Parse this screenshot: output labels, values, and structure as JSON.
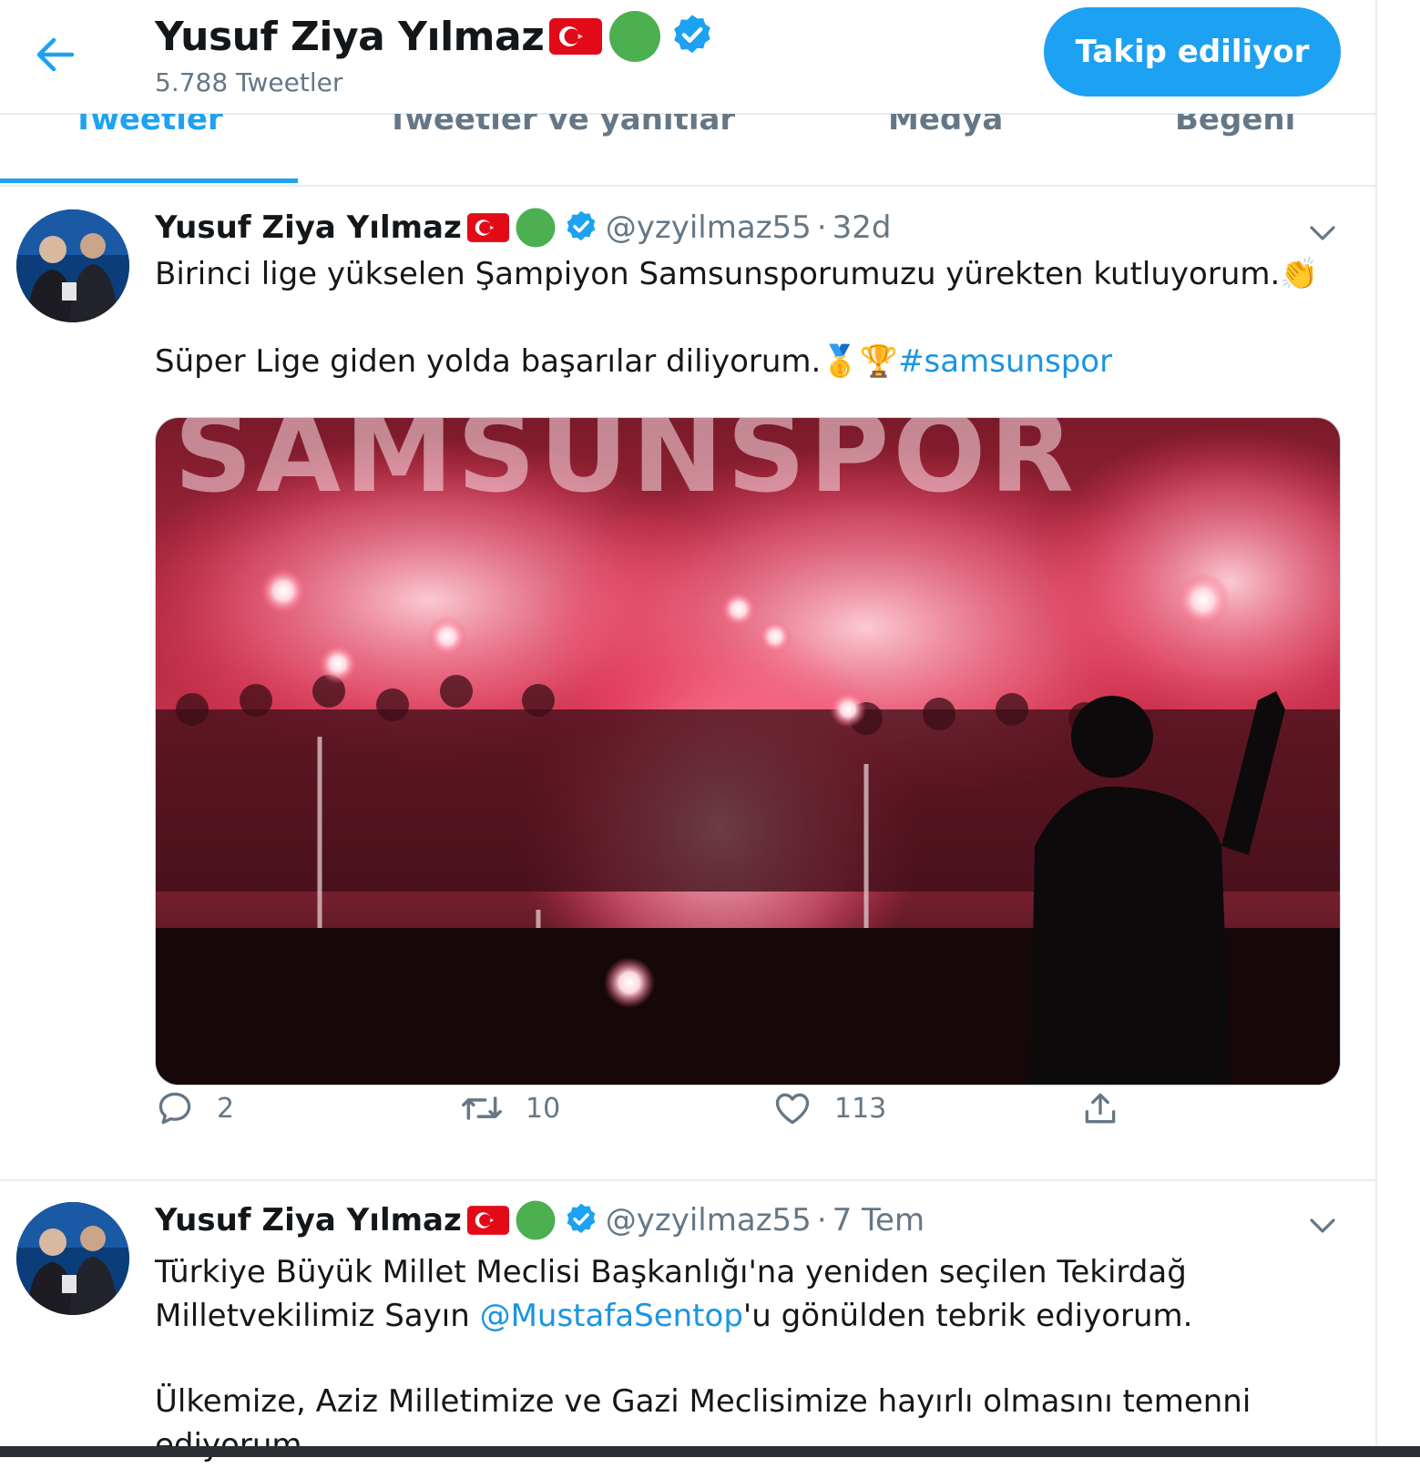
{
  "header": {
    "name": "Yusuf Ziya Yılmaz",
    "tweet_count": "5.788 Tweetler",
    "follow_label": "Takip ediliyor"
  },
  "tabs": [
    {
      "label": "Tweetler",
      "active": true
    },
    {
      "label": "Tweetler ve yanıtlar",
      "active": false
    },
    {
      "label": "Medya",
      "active": false
    },
    {
      "label": "Beğeni",
      "active": false
    }
  ],
  "tweets": [
    {
      "name": "Yusuf Ziya Yılmaz",
      "handle": "@yzyilmaz55",
      "separator": "·",
      "time": "32d",
      "line1": "Birinci lige yükselen Şampiyon  Samsunsporumuzu yürekten kutluyorum.",
      "line1_emoji": "👏",
      "line2": "Süper Lige giden yolda başarılar diliyorum.",
      "line2_emoji": "🥇🏆",
      "hashtag": "#samsunspor",
      "media_watermark": "SAMSUNSPOR",
      "replies": "2",
      "retweets": "10",
      "likes": "113"
    },
    {
      "name": "Yusuf Ziya Yılmaz",
      "handle": "@yzyilmaz55",
      "separator": "·",
      "time": "7 Tem",
      "line1": "Türkiye Büyük Millet Meclisi Başkanlığı'na yeniden seçilen Tekirdağ",
      "line2_pre": "Milletvekilimiz Sayın ",
      "mention": "@MustafaSentop",
      "line2_post": "'u gönülden tebrik ediyorum.",
      "line3": "Ülkemize, Aziz Milletimize ve Gazi Meclisimize hayırlı olmasını temenni",
      "line4": "ediyorum."
    }
  ],
  "colors": {
    "accent": "#1da1f2",
    "verified": "#1da1f2",
    "text": "#14171a",
    "secondary": "#657786",
    "status_dot": "#4caf50",
    "flag_red": "#e30a17"
  },
  "icons": [
    "back-arrow-icon",
    "turkey-flag-icon",
    "green-circle-icon",
    "verified-badge-icon",
    "chevron-down-icon",
    "reply-icon",
    "retweet-icon",
    "like-icon",
    "share-icon"
  ]
}
